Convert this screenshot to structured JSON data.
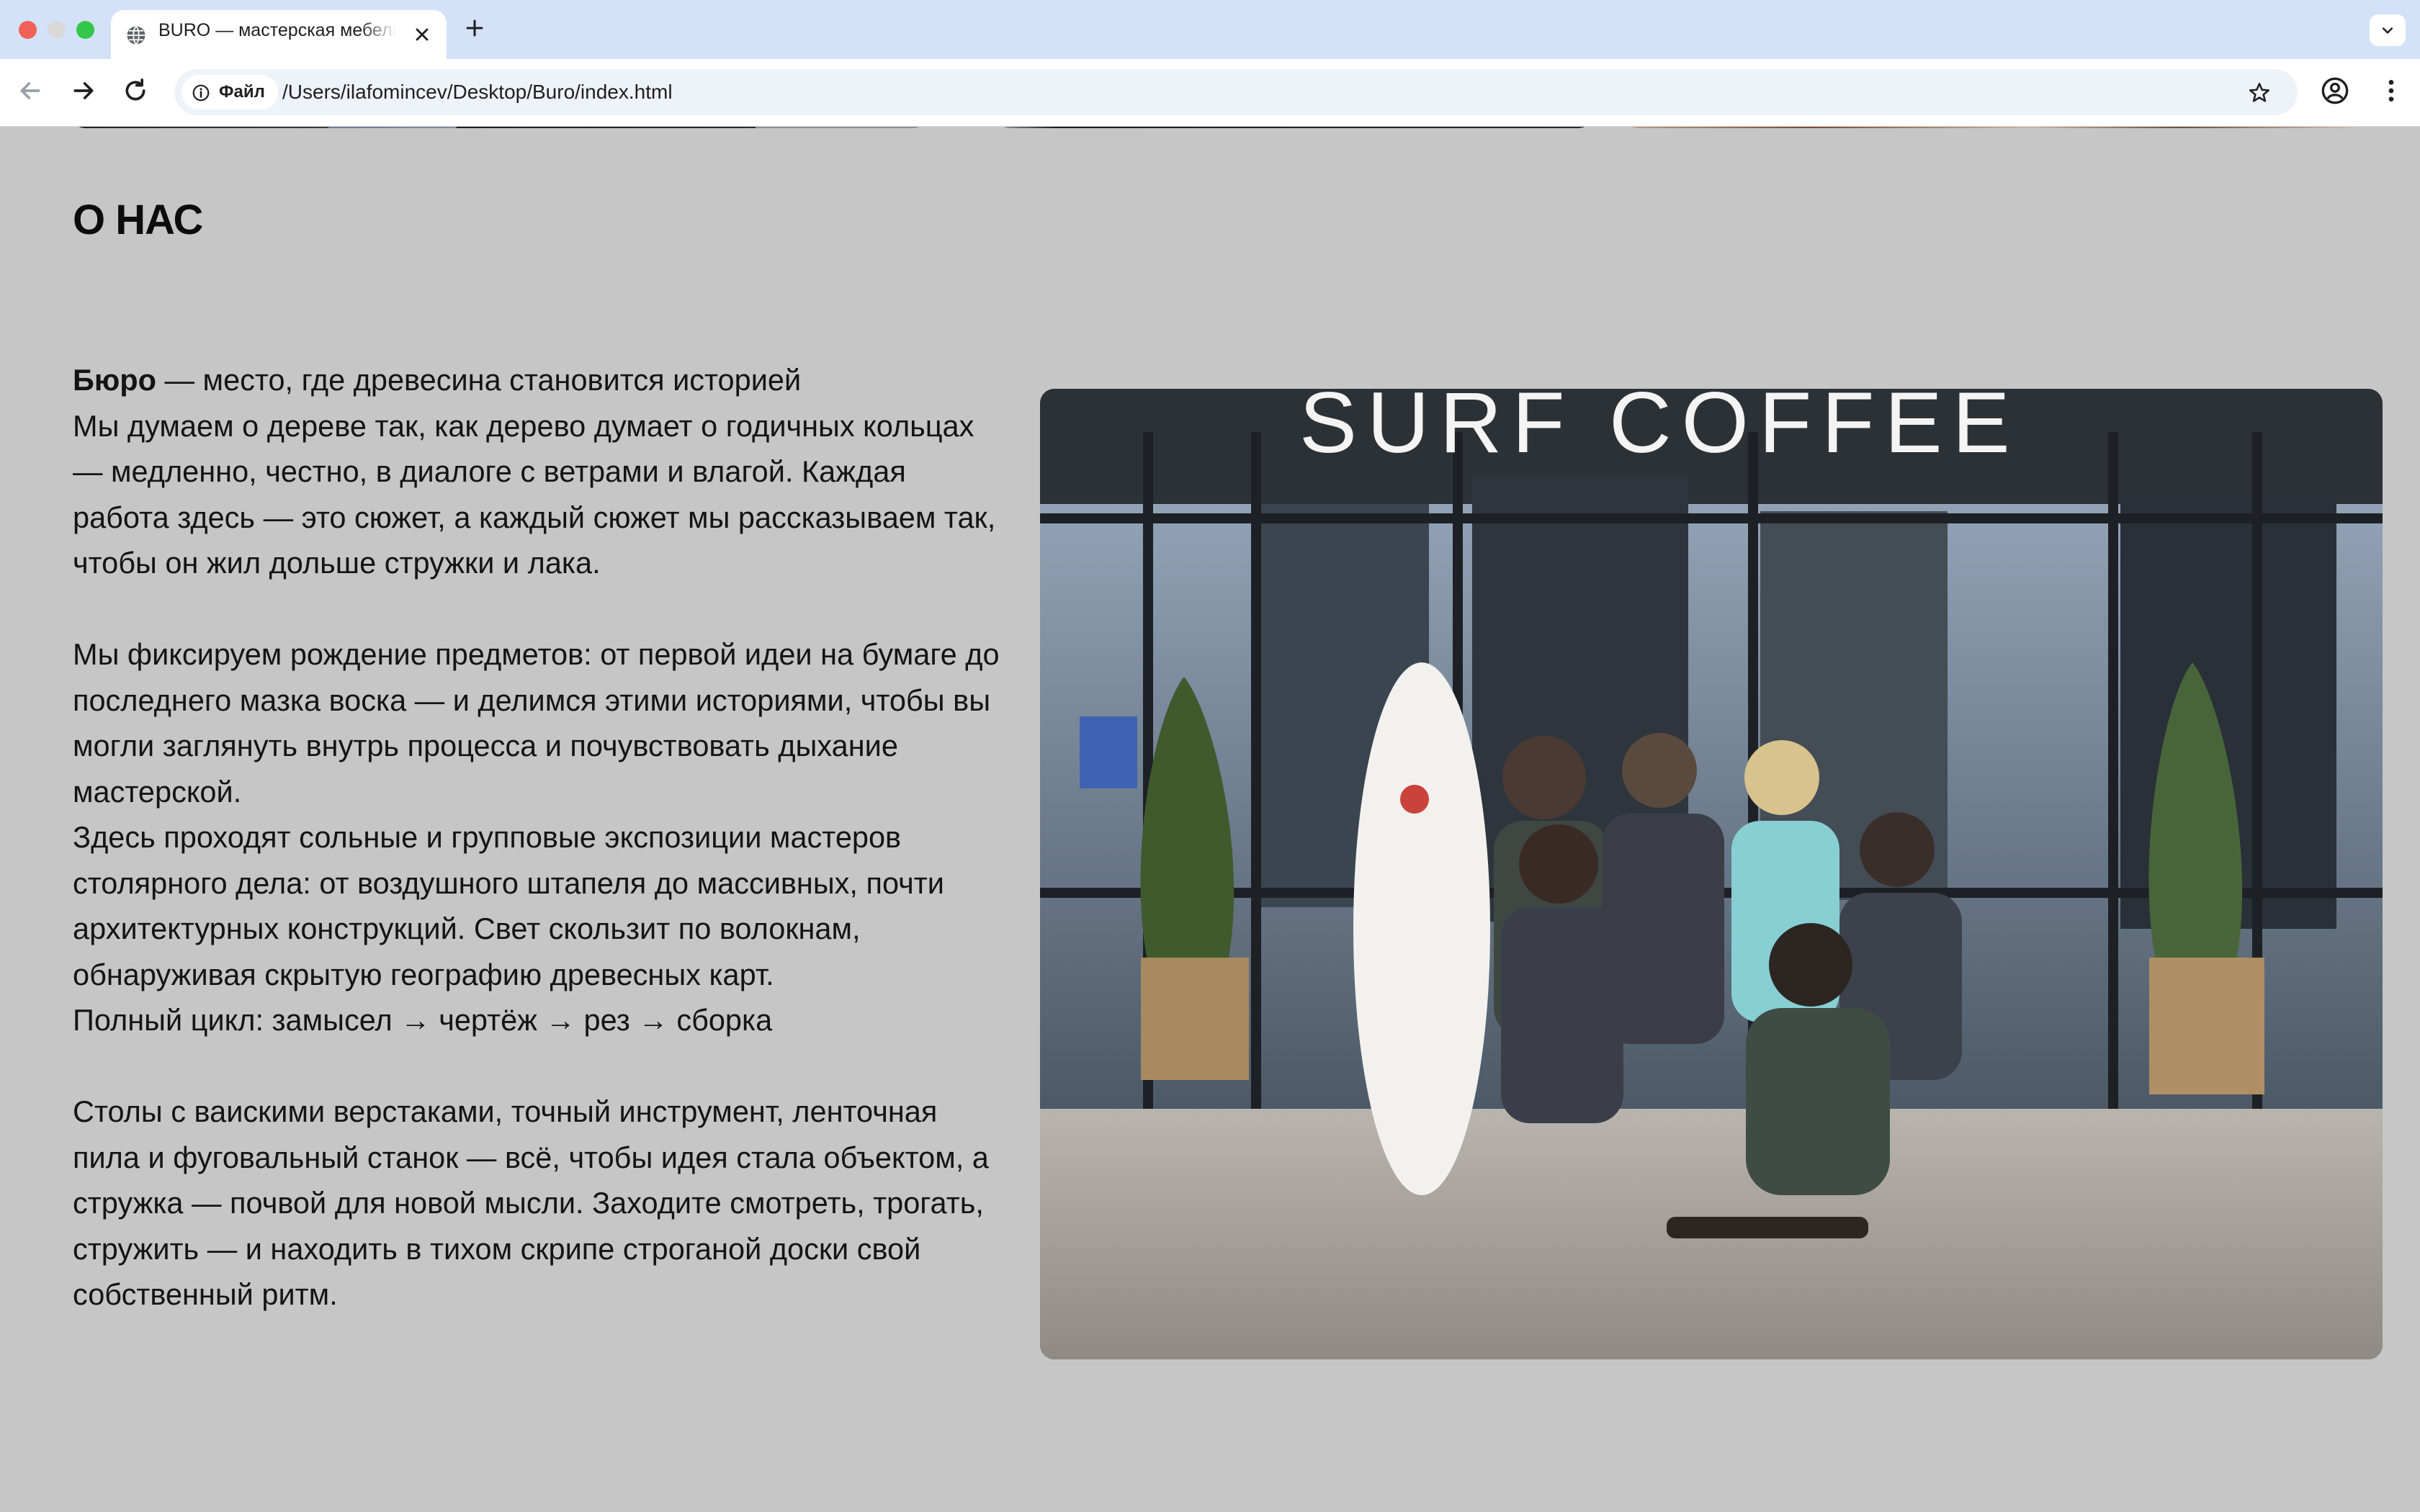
{
  "browser": {
    "tab_title": "BURO — мастерская мебели",
    "security_chip": "Файл",
    "url": "/Users/ilafomincev/Desktop/Buro/index.html"
  },
  "about": {
    "heading": "О НАС",
    "brand": "Бюро",
    "lead_rest": " — место, где древесина становится историей",
    "p1": "Мы думаем о дереве так, как дерево думает о годичных кольцах — медленно, честно, в диалоге с ветрами и влагой. Каждая работа здесь — это сюжет, а каждый сюжет мы рассказываем так, чтобы он жил дольше стружки и лака.",
    "p2": "Мы фиксируем рождение предметов: от первой идеи на бумаге до последнего мазка воска — и делимся этими историями, чтобы вы могли заглянуть внутрь процесса и почувствовать дыхание мастерской.",
    "p3": "Здесь проходят сольные и групповые экспозиции мастеров столярного дела: от воздушного штапеля до массивных, почти архитектурных конструкций. Свет скользит по волокнам, обнаруживая скрытую географию древесных карт.",
    "p4": "Полный цикл: замысел → чертёж → рез → сборка",
    "p5": "Столы с ваискими верстаками, точный инструмент, ленточная пила и фуговальный станок — всё, чтобы идея стала объектом, а стружка — почвой для новой мысли. Заходите смотреть, трогать, стружить — и находить в тихом скрипе строганой доски свой собственный ритм."
  },
  "photo": {
    "sign_text": "SURF COFFEE"
  }
}
